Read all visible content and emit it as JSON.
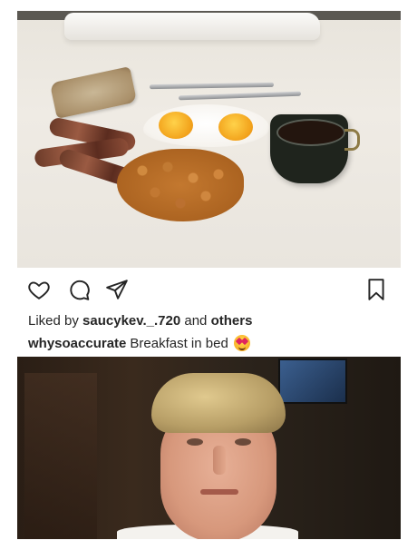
{
  "post": {
    "photo_subject": "breakfast-in-bed",
    "actions": {
      "like_icon": "heart-icon",
      "comment_icon": "comment-icon",
      "share_icon": "send-icon",
      "save_icon": "bookmark-icon"
    },
    "likes": {
      "prefix": "Liked by",
      "user": "saucykev._.720",
      "joiner": "and",
      "others": "others"
    },
    "caption": {
      "username": "whysoaccurate",
      "text": "Breakfast in bed",
      "emoji": "heart-eyes-emoji"
    }
  },
  "reaction": {
    "subject": "reaction-face"
  },
  "colors": {
    "text": "#262626",
    "background": "#ffffff"
  }
}
